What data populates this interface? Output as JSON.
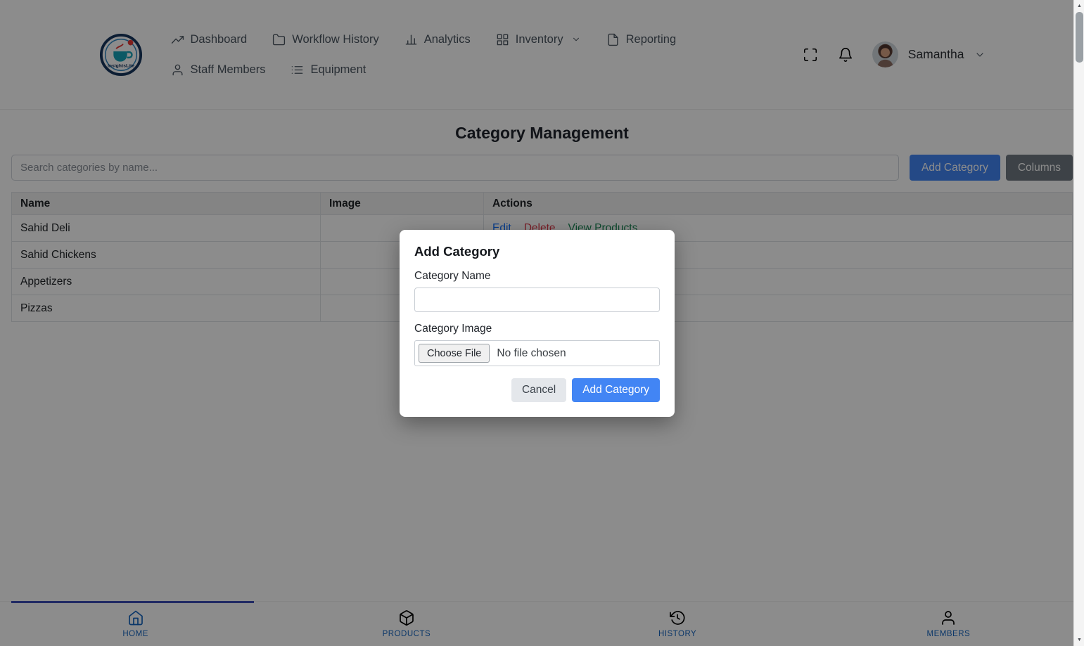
{
  "brand": {
    "name": "InsightsLite"
  },
  "header": {
    "nav": [
      {
        "label": "Dashboard"
      },
      {
        "label": "Workflow History"
      },
      {
        "label": "Analytics"
      },
      {
        "label": "Inventory"
      },
      {
        "label": "Reporting"
      },
      {
        "label": "Staff Members"
      },
      {
        "label": "Equipment"
      }
    ],
    "user": {
      "name": "Samantha"
    }
  },
  "main": {
    "title": "Category Management",
    "search_placeholder": "Search categories by name...",
    "buttons": {
      "add_category": "Add Category",
      "columns": "Columns"
    },
    "table": {
      "headers": [
        "Name",
        "Image",
        "Actions"
      ],
      "rows": [
        {
          "name": "Sahid Deli"
        },
        {
          "name": "Sahid Chickens"
        },
        {
          "name": "Appetizers"
        },
        {
          "name": "Pizzas"
        }
      ],
      "row_actions": {
        "edit": "Edit",
        "delete": "Delete",
        "view_products": "View Products"
      }
    }
  },
  "modal": {
    "title": "Add Category",
    "category_name_label": "Category Name",
    "category_name_value": "",
    "category_image_label": "Category Image",
    "file_button": "Choose File",
    "file_status": "No file chosen",
    "cancel": "Cancel",
    "submit": "Add Category"
  },
  "footer": {
    "tabs": [
      {
        "label": "HOME"
      },
      {
        "label": "PRODUCTS"
      },
      {
        "label": "HISTORY"
      },
      {
        "label": "MEMBERS"
      }
    ]
  },
  "colors": {
    "primary": "#4285f4",
    "columns_button": "#6f7982",
    "edit_link": "#0d6efd",
    "delete_link": "#dc3545",
    "view_products_link": "#198754",
    "tab_indicator": "#3d4db7",
    "active_tab": "#1565c0"
  }
}
